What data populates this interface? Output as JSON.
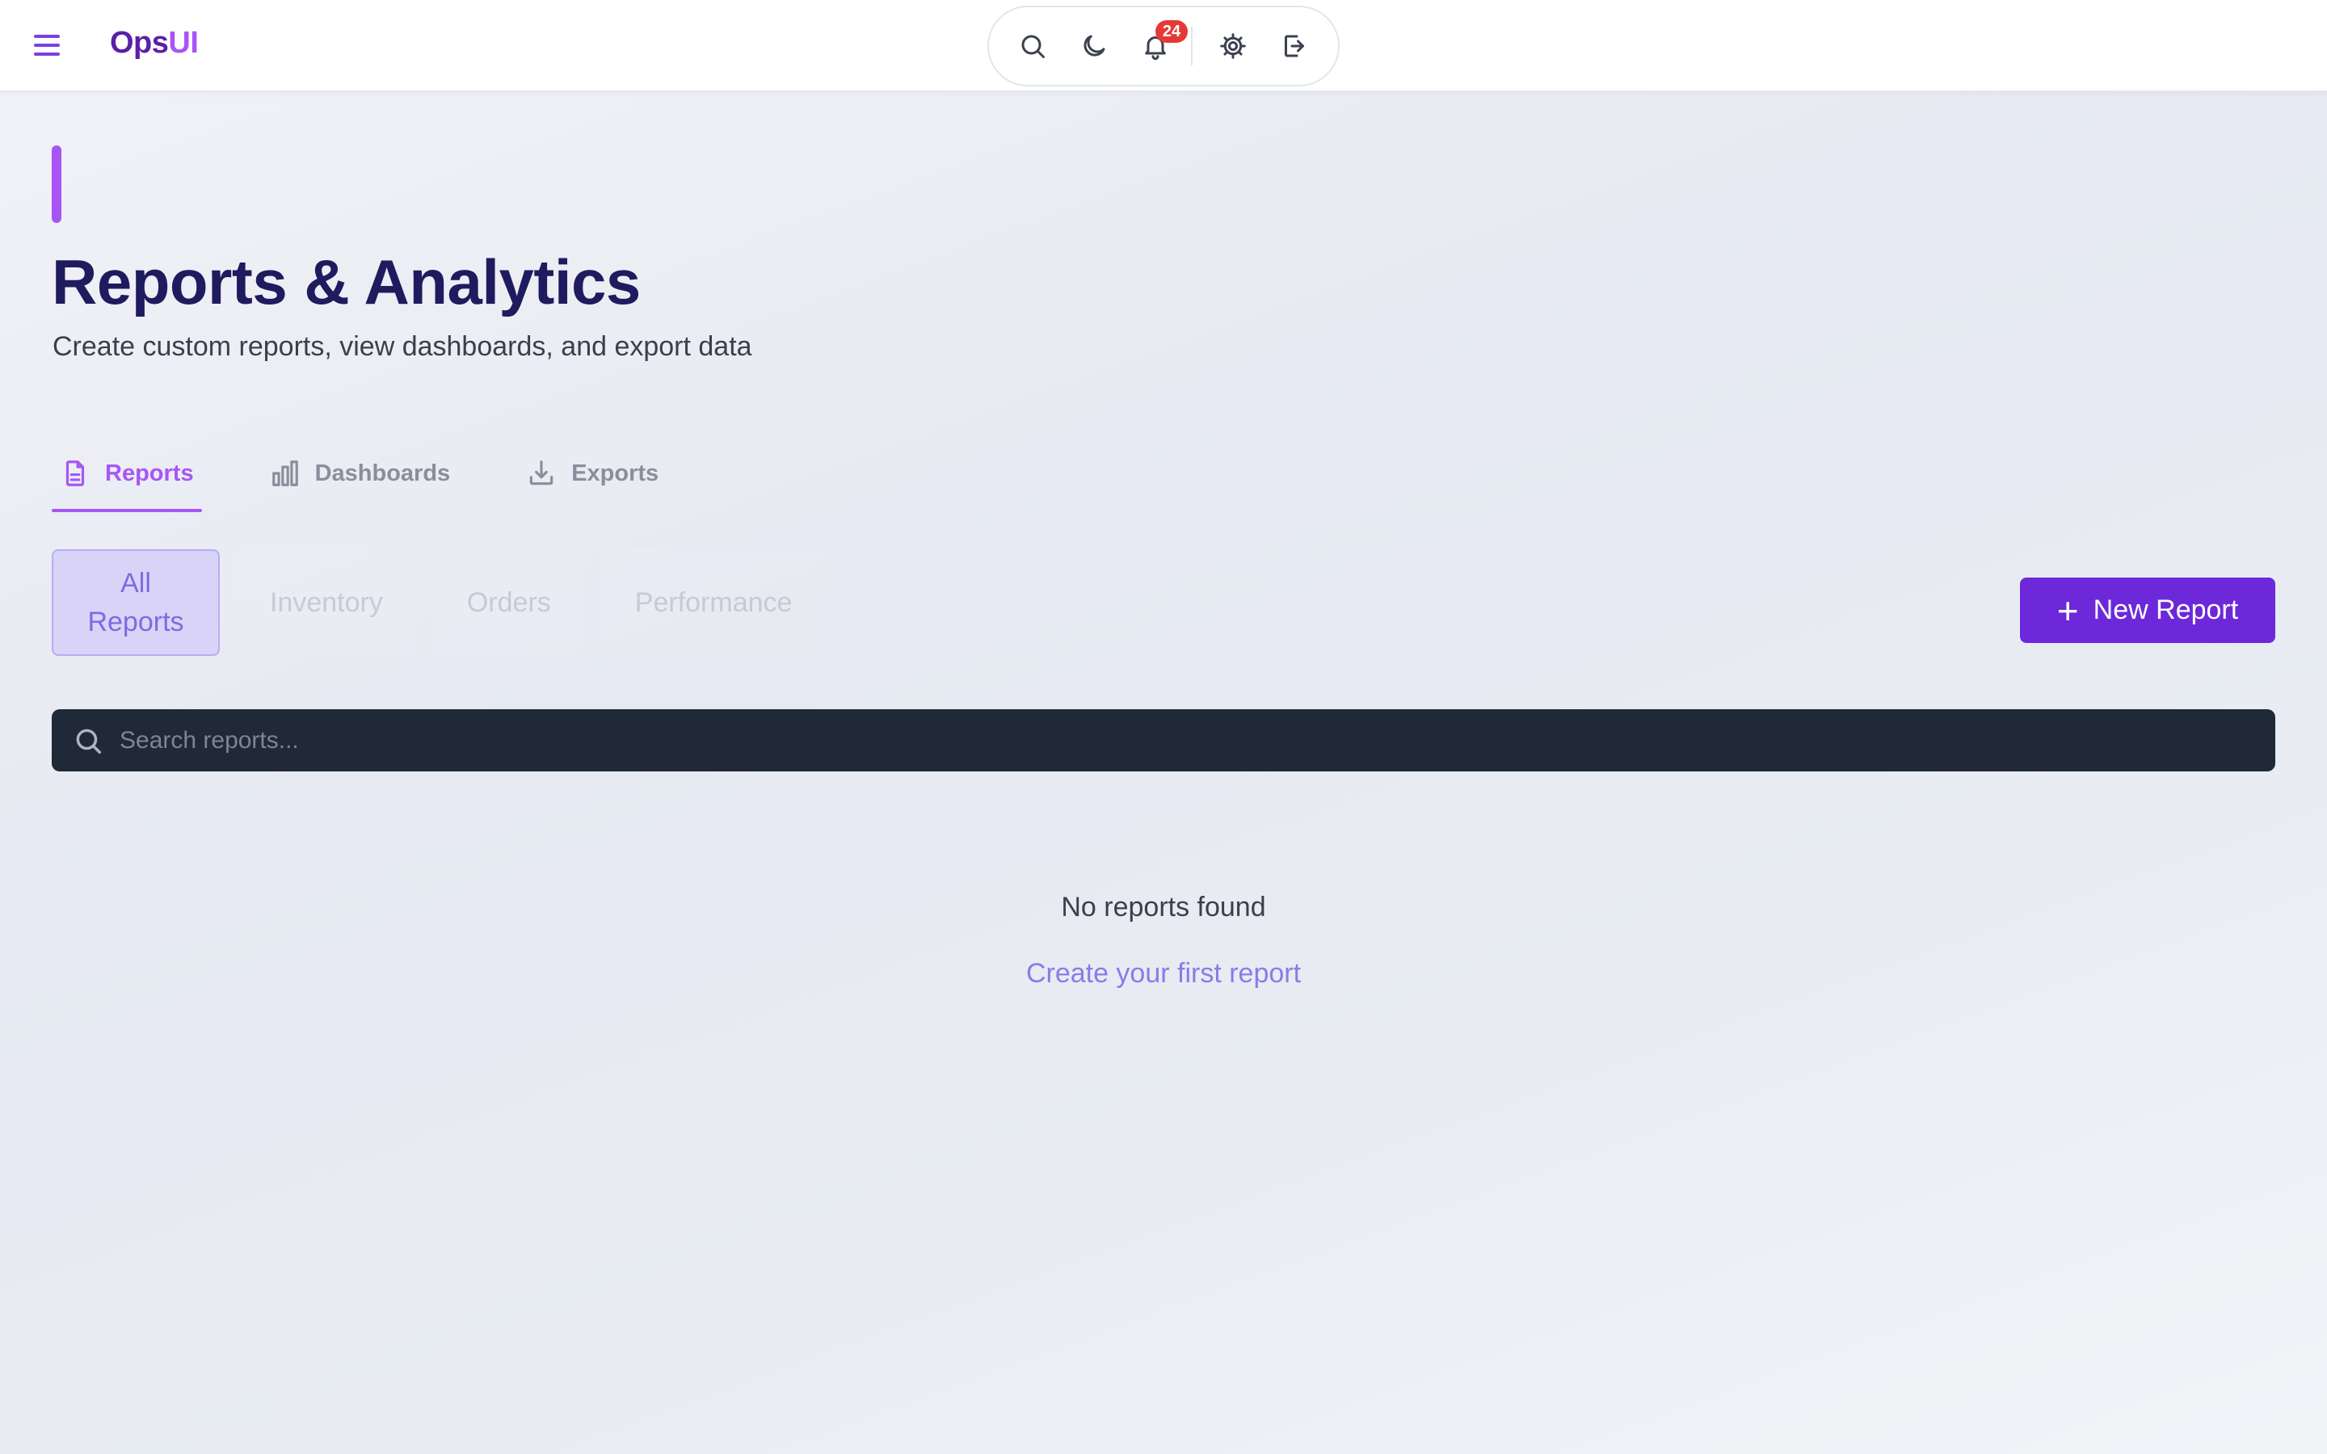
{
  "app": {
    "brand_part1": "Ops",
    "brand_part2": "UI",
    "notification_count": "24",
    "colors": {
      "accent": "#a855f7",
      "primary_button": "#6d28d9",
      "title": "#1e1b5e",
      "search_bg": "#1f2937",
      "badge": "#e53935"
    }
  },
  "header_icons": [
    "menu-icon",
    "search-icon",
    "moon-icon",
    "bell-icon",
    "gear-icon",
    "logout-icon"
  ],
  "page": {
    "title": "Reports & Analytics",
    "subtitle": "Create custom reports, view dashboards, and export data"
  },
  "tabs": [
    {
      "label": "Reports",
      "icon": "document-icon",
      "active": true
    },
    {
      "label": "Dashboards",
      "icon": "bar-chart-icon",
      "active": false
    },
    {
      "label": "Exports",
      "icon": "download-icon",
      "active": false
    }
  ],
  "filters": [
    {
      "label": "All Reports",
      "active": true
    },
    {
      "label": "Inventory",
      "active": false
    },
    {
      "label": "Orders",
      "active": false
    },
    {
      "label": "Performance",
      "active": false
    }
  ],
  "new_report_label": "New Report",
  "search": {
    "placeholder": "Search reports...",
    "value": ""
  },
  "empty_state": {
    "message": "No reports found",
    "link": "Create your first report"
  }
}
